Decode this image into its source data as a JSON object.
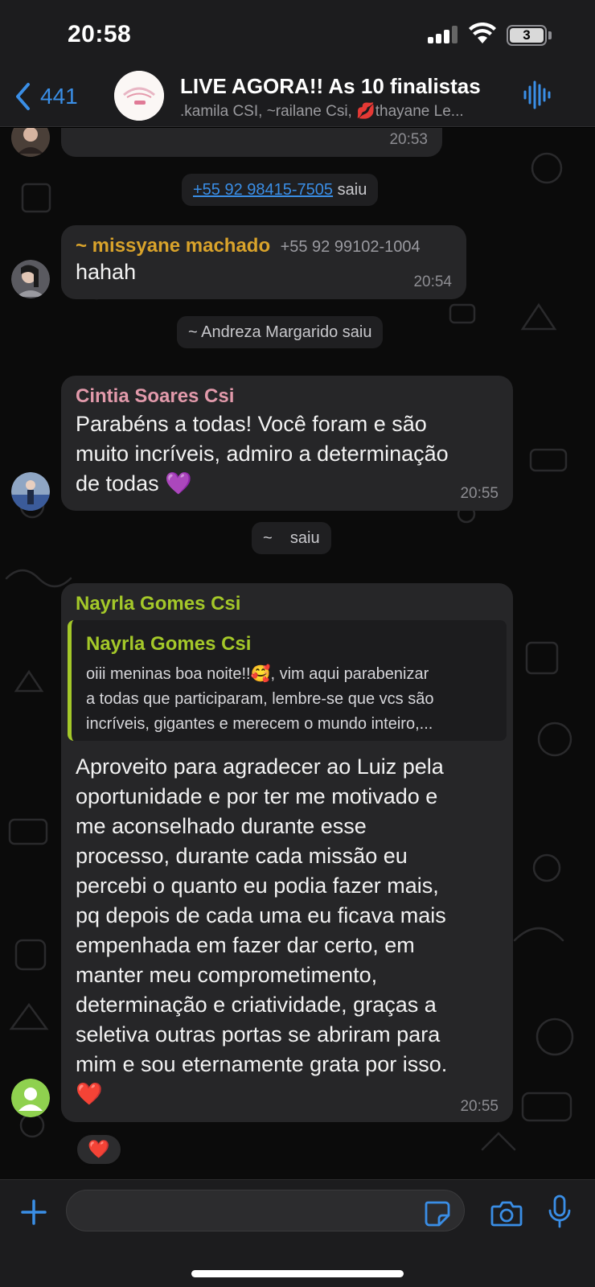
{
  "status_bar": {
    "time": "20:58",
    "battery": "3"
  },
  "header": {
    "back_count": "441",
    "title": "LIVE AGORA!! As 10 finalistas",
    "subtitle": ".kamila CSI, ~railane  Csi, 💋thayane Le..."
  },
  "messages": {
    "top_partial": {
      "time": "20:53"
    },
    "system_1": {
      "phone": "+55 92 98415-7505",
      "action": "saiu"
    },
    "missyane": {
      "sender": "~ missyane machado",
      "phone": "+55 92 99102-1004",
      "text": "hahah",
      "time": "20:54"
    },
    "system_2": {
      "text": "~ Andreza Margarido saiu"
    },
    "cintia": {
      "sender": "Cintia Soares Csi",
      "lines": [
        "Parabéns a todas! Você foram e são",
        "muito incríveis, admiro a determinação",
        "de todas 💜"
      ],
      "time": "20:55"
    },
    "system_3": {
      "text": "~    saiu"
    },
    "nayrla": {
      "sender": "Nayrla Gomes Csi",
      "quote_sender": "Nayrla Gomes Csi",
      "quote_lines": [
        "oiii meninas boa noite!!🥰, vim aqui parabenizar",
        "a todas que participaram, lembre-se que vcs são",
        "incríveis, gigantes e merecem o mundo inteiro,..."
      ],
      "lines": [
        "Aproveito para agradecer ao Luiz pela",
        "oportunidade e por ter me motivado e",
        "me aconselhado durante esse",
        "processo, durante cada missão eu",
        "percebi o quanto eu podia fazer mais,",
        "pq depois de cada uma eu ficava mais",
        "empenhada em fazer dar certo, em",
        "manter meu comprometimento,",
        "determinação e criatividade, graças a",
        "seletiva outras portas se abriram para",
        "mim e sou eternamente grata por isso.",
        "❤️"
      ],
      "time": "20:55",
      "reaction": "❤️"
    }
  },
  "input": {
    "placeholder": ""
  }
}
